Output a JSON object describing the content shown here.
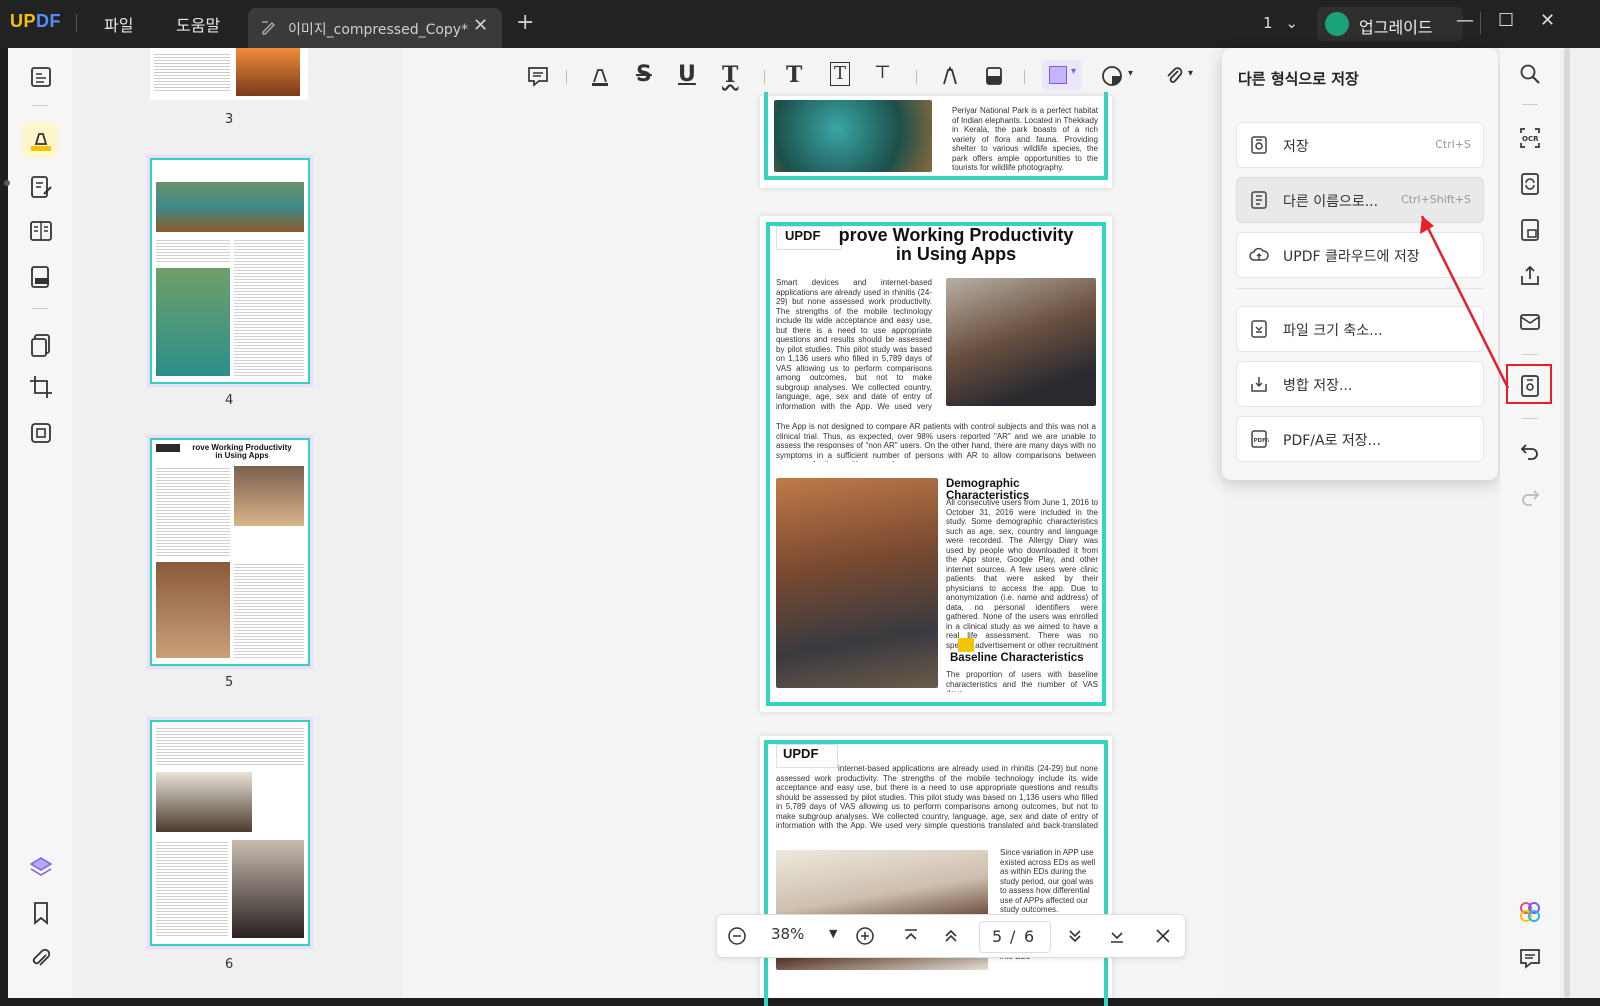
{
  "app": {
    "logo": "UPDF",
    "menus": [
      "파일",
      "도움말"
    ]
  },
  "tab": {
    "title": "이미지_compressed_Copy*",
    "close": "✕",
    "new": "+"
  },
  "titlebar": {
    "page_indicator": "1",
    "upgrade_label": "업그레이드",
    "minimize": "—",
    "maximize": "☐",
    "close": "✕"
  },
  "thumbnails": [
    {
      "num": "3"
    },
    {
      "num": "4"
    },
    {
      "num": "5"
    },
    {
      "num": "6"
    }
  ],
  "page_prev_tail": "Periyar National Park is a perfect habitat of Indian elephants. Located in Thekkady in Kerala, the park boasts of a rich variety of flora and fauna. Providing shelter to various wildlife species, the park offers ample opportunities to the tourists for wildlife photography.",
  "page_current": {
    "logo": "UPDF",
    "title_line1": "prove Working Productivity",
    "title_line2": "in Using Apps",
    "para1": "Smart devices and internet-based applications are already used in rhinitis (24-29) but none assessed work productivity. The strengths of the mobile technology include its wide acceptance and easy use, but there is a need to use appropriate questions and results should be assessed by pilot studies. This pilot study was based on 1,136 users who filled in 5,789 days of VAS allowing us to perform comparisons among outcomes, but not to make subgroup analyses. We collected country, language, age, sex and date of entry of information with the App. We used very simple questions translated and back-translated into 15 languages.",
    "para2": "The App is not designed to compare AR patients with control subjects and this was not a clinical trial. Thus, as expected, over 98% users reported \"AR\" and we are unable to assess the responses of \"non AR\" users. On the other hand, there are many days with no symptoms in a sufficient number of persons with AR to allow comparisons between outcomes for those with more or less symptoms.",
    "heading2": "Demographic Characteristics",
    "para3": "All consecutive users from June 1, 2016 to October 31, 2016 were included in the study. Some demographic characteristics such as age, sex, country and language were recorded. The Allergy Diary was used by people who downloaded it from the App store, Google Play, and other internet sources. A few users were clinic patients that were asked by their physicians to access the app. Due to anonymization (i.e. name and address) of data, no personal identifiers were gathered. None of the users was enrolled in a clinical study as we aimed to have a real life assessment. There was no specific advertisement or other recruitment campaign (31).",
    "heading3": "Baseline Characteristics",
    "para4": "The proportion of users with baseline characteristics and the number of VAS days"
  },
  "page_next": {
    "logo": "UPDF",
    "para1": "internet-based applications are already used in rhinitis (24-29) but none assessed work productivity. The strengths of the mobile technology include its wide acceptance and easy use, but there is a need to use appropriate questions and results should be assessed by pilot studies. This pilot study was based on 1,136 users who filled in 5,789 days of VAS allowing us to perform comparisons among outcomes, but not to make subgroup analyses. We collected country, language, age, sex and date of entry of information with the App. We used very simple questions translated and back-translated into 15 languages.",
    "para2": "Since variation in APP use existed across EDs as well as within EDs during the study period, our goal was to assess how differential use of APPs affected our study outcomes.",
    "tail": "into EDs"
  },
  "save_panel": {
    "title": "다른 형식으로 저장",
    "options": [
      {
        "label": "저장",
        "shortcut": "Ctrl+S",
        "icon": "save-icon"
      },
      {
        "label": "다른 이름으로...",
        "shortcut": "Ctrl+Shift+S",
        "icon": "save-as-icon"
      },
      {
        "label": "UPDF 클라우드에 저장",
        "shortcut": "",
        "icon": "cloud-icon"
      },
      {
        "label": "파일 크기 축소...",
        "shortcut": "",
        "icon": "compress-icon"
      },
      {
        "label": "병합 저장...",
        "shortcut": "",
        "icon": "flatten-icon"
      },
      {
        "label": "PDF/A로 저장...",
        "shortcut": "",
        "icon": "pdfa-icon"
      }
    ]
  },
  "zoom": {
    "value": "38%",
    "current_page": "5",
    "separator": "/",
    "total_pages": "6"
  },
  "colors": {
    "accent": "#34d4c1",
    "highlight_box": "#e5202a",
    "brand_yellow": "#f5c400",
    "brand_blue": "#5a8cff"
  }
}
